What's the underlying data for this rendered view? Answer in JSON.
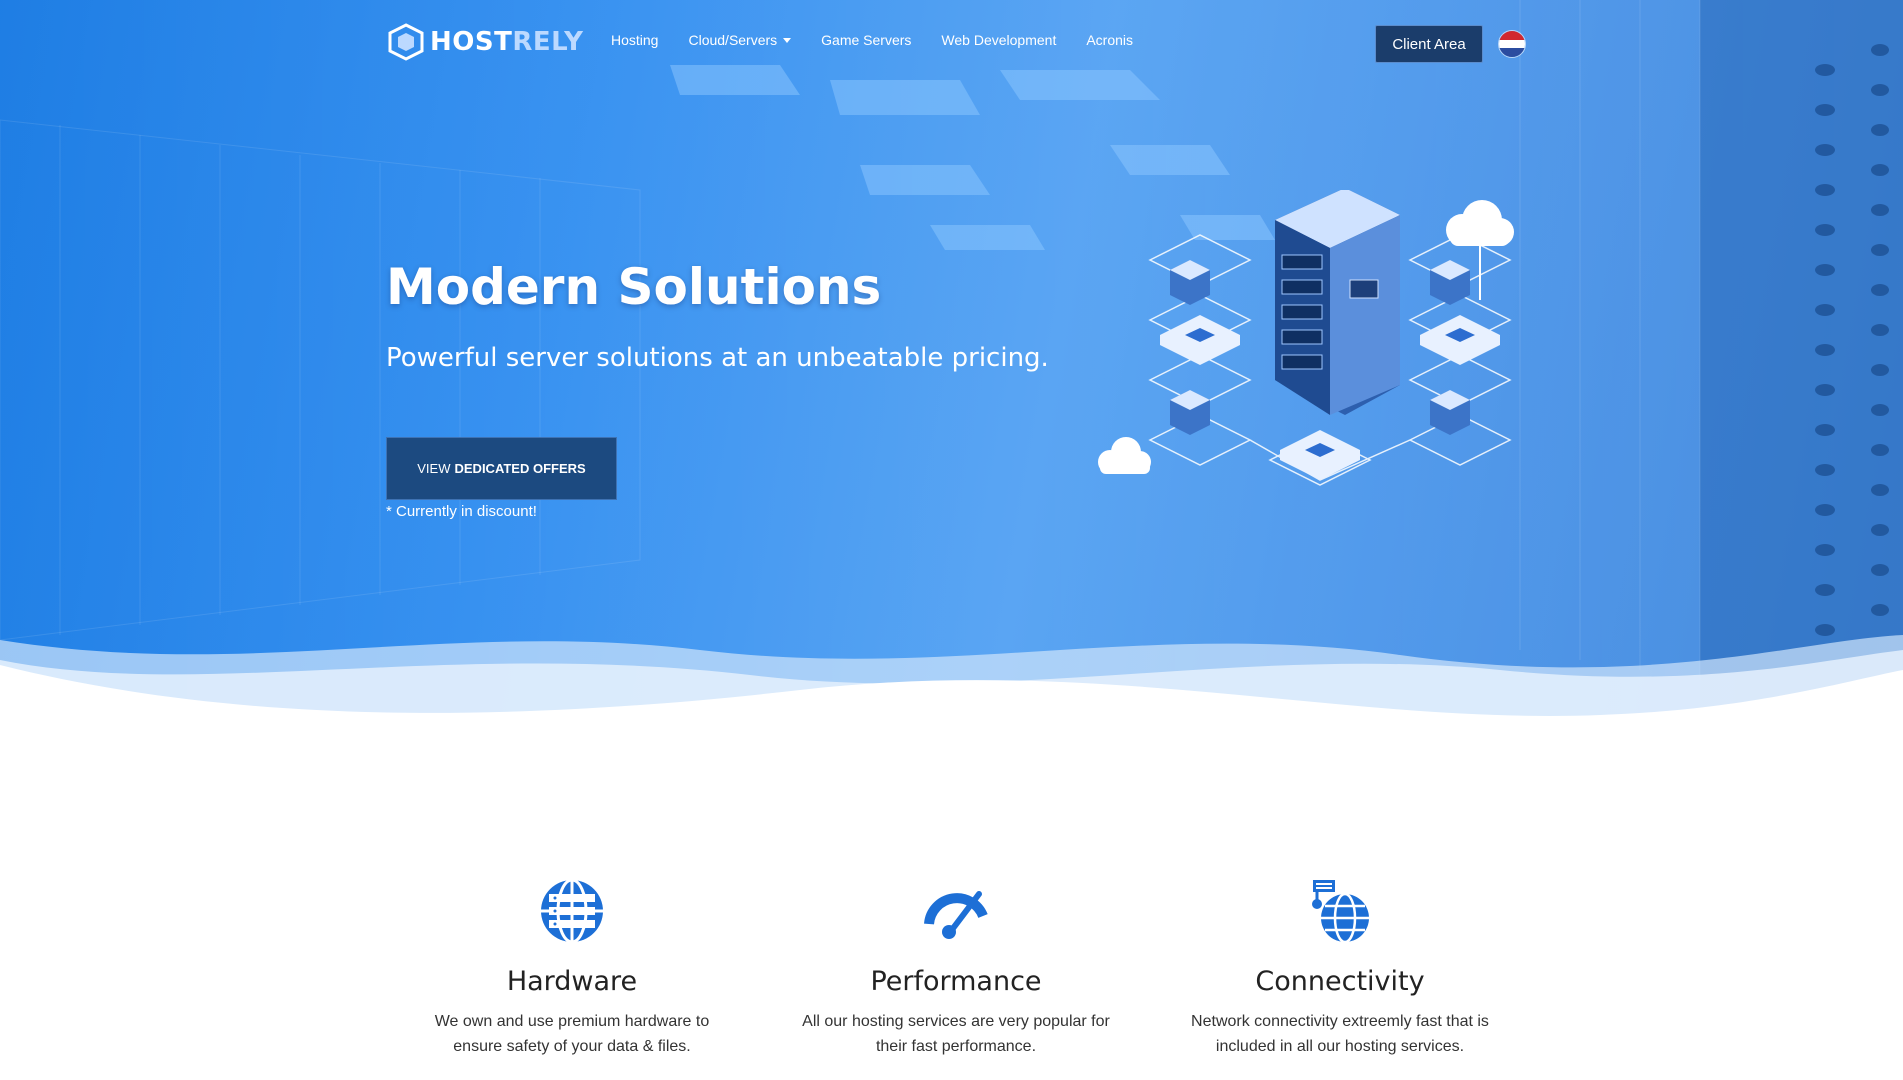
{
  "brand": {
    "part1": "HOST",
    "part2": "RELY"
  },
  "nav": {
    "items": [
      {
        "label": "Hosting"
      },
      {
        "label": "Cloud/Servers"
      },
      {
        "label": "Game Servers"
      },
      {
        "label": "Web Development"
      },
      {
        "label": "Acronis"
      }
    ],
    "client_area": "Client Area"
  },
  "hero": {
    "title": "Modern Solutions",
    "subtitle": "Powerful server solutions at an unbeatable pricing.",
    "cta_prefix": "VIEW",
    "cta_bold": "DEDICATED OFFERS",
    "note": "* Currently in discount!"
  },
  "features": [
    {
      "icon": "globe-server-icon",
      "title": "Hardware",
      "text": "We own and use premium hardware to ensure safety of your data & files."
    },
    {
      "icon": "speedometer-icon",
      "title": "Performance",
      "text": "All our hosting services are very popular for their fast performance."
    },
    {
      "icon": "network-globe-icon",
      "title": "Connectivity",
      "text": "Network connectivity extreemly fast that is included in all our hosting services."
    }
  ],
  "colors": {
    "hero_blue": "#2f8df0",
    "button_dark": "#1b3d6b",
    "icon_blue": "#1d6fd6"
  }
}
